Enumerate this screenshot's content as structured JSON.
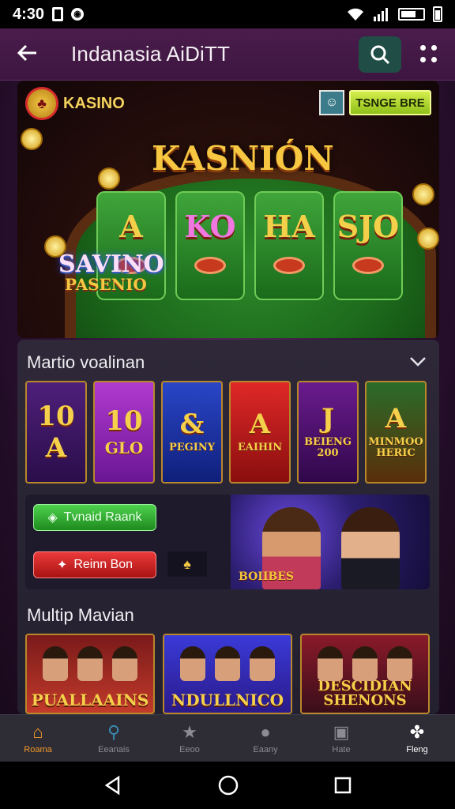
{
  "status_bar": {
    "time": "4:30",
    "notif_icon": "square-icon",
    "app_icon": "circle-icon"
  },
  "app_bar": {
    "title": "Indanasia AiDiTT"
  },
  "hero": {
    "logo_text": "KASINO",
    "button_label": "TSNGE BRE",
    "title": "KASNIÓN",
    "reels": [
      "A",
      "KO",
      "HA",
      "SJO"
    ],
    "sub_title": "SAVINO",
    "sub_title2": "PASENIO"
  },
  "games_section": {
    "title": "Martio voalinan",
    "cards": [
      {
        "big": "10",
        "small": "A"
      },
      {
        "big": "10",
        "small": "GLO"
      },
      {
        "big": "&",
        "small": "PEGINY"
      },
      {
        "big": "A",
        "small": "EAIHIN"
      },
      {
        "big": "J",
        "small": "BEIENG 200"
      },
      {
        "big": "A",
        "small": "MINMOO HERIC"
      }
    ]
  },
  "promo": {
    "green_button": "Tvnaid Raank",
    "red_button": "Reinn Bon",
    "art_label": "BOIIBES"
  },
  "featured_section": {
    "title": "Multip Mavian",
    "cards": [
      "PUALLAAINS",
      "NDULLNICO",
      "DESCIDIAN SHENONS"
    ]
  },
  "bottom_nav": [
    {
      "label": "Roama",
      "icon": "home-icon"
    },
    {
      "label": "Eeanais",
      "icon": "search-icon"
    },
    {
      "label": "Eeoo",
      "icon": "star-icon"
    },
    {
      "label": "Eaany",
      "icon": "user-icon"
    },
    {
      "label": "Hate",
      "icon": "bag-icon"
    },
    {
      "label": "Fleng",
      "icon": "puzzle-icon"
    }
  ],
  "colors": {
    "accent": "#f39a2a",
    "brand": "#4a1c4c",
    "search_bg": "#204e46"
  }
}
